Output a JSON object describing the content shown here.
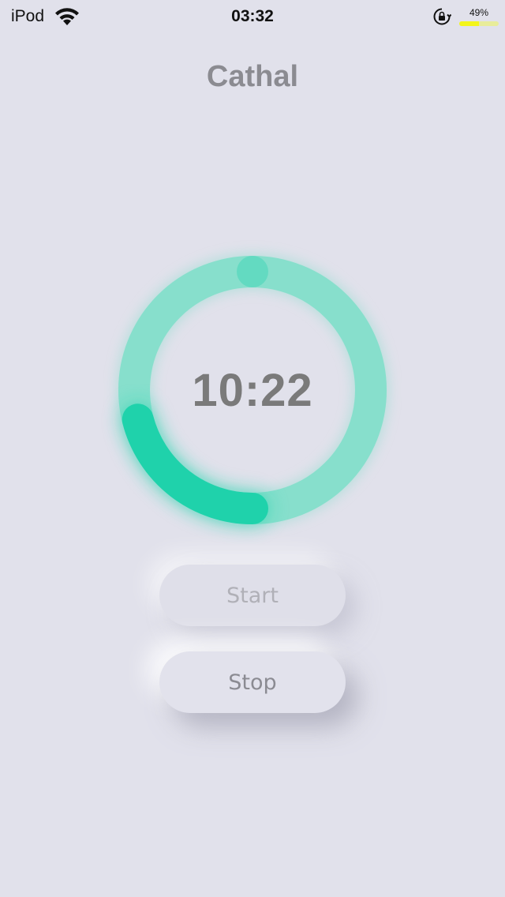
{
  "status_bar": {
    "carrier": "iPod",
    "time": "03:32",
    "battery_percent_label": "49%",
    "battery_level": 0.49,
    "icons": [
      "wifi-icon",
      "lock-rotation-icon"
    ]
  },
  "header": {
    "title": "Cathal"
  },
  "timer": {
    "display": "10:22",
    "progress_fraction": 0.3,
    "ring_color": "#1fd2ab",
    "ring_track_color": "#7dddc8"
  },
  "controls": {
    "start_label": "Start",
    "stop_label": "Stop",
    "start_enabled": false
  },
  "colors": {
    "background": "#e1e1eb",
    "title": "#8b8b91",
    "timer_text": "#7a7a7a"
  }
}
